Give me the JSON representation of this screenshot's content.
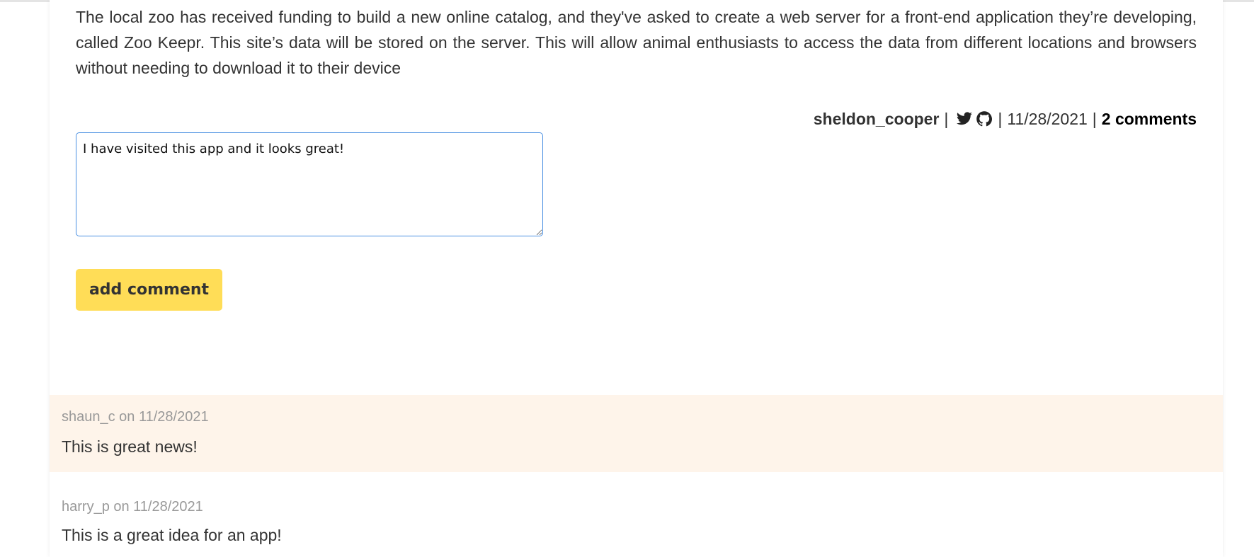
{
  "post": {
    "description": "The local zoo has received funding to build a new online catalog, and they've asked to create a web server for a front-end application they’re developing, called Zoo Keepr. This site’s data will be stored on the server. This will allow animal enthusiasts to access the data from different locations and browsers without needing to download it to their device",
    "author": "sheldon_cooper",
    "separator": "|",
    "date": "11/28/2021",
    "comments_count_label": "2 comments",
    "icons": [
      "twitter-icon",
      "github-icon"
    ]
  },
  "comment_form": {
    "textarea_value": "I have visited this app and it looks great!",
    "submit_label": "add comment"
  },
  "comments": [
    {
      "meta": "shaun_c on 11/28/2021",
      "text": "This is great news!"
    },
    {
      "meta": "harry_p on 11/28/2021",
      "text": "This is a great idea for an app!"
    }
  ],
  "colors": {
    "button": "#ffdd57",
    "highlight": "#fef4ea",
    "textarea_border": "#4a90e2"
  }
}
